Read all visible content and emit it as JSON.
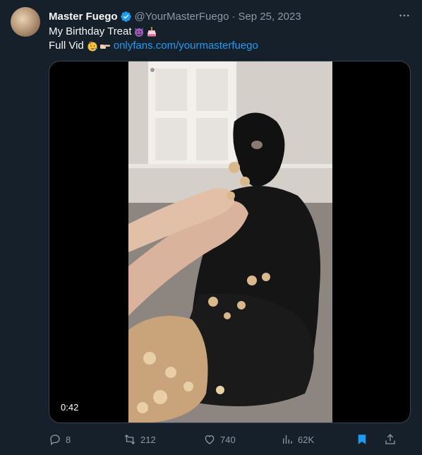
{
  "tweet": {
    "display_name": "Master Fuego",
    "handle": "@YourMasterFuego",
    "separator": "·",
    "date": "Sep 25, 2023",
    "line1_text": "My Birthday Treat",
    "line2_text": "Full Vid",
    "link_text": "onlyfans.com/yourmasterfuego",
    "emoji_line1": [
      "smiling-devil-emoji",
      "birthday-cake-emoji"
    ],
    "emoji_line2": [
      "partying-face-emoji",
      "pointing-right-emoji"
    ]
  },
  "media": {
    "type": "video",
    "duration": "0:42"
  },
  "actions": {
    "replies": "8",
    "reposts": "212",
    "likes": "740",
    "views": "62K"
  },
  "colors": {
    "background": "#15202b",
    "text": "#f7f9f9",
    "muted": "#8b98a5",
    "link": "#1d9bf0",
    "verified": "#1d9bf0"
  },
  "icons": {
    "more": "more-dots-icon",
    "reply": "reply-icon",
    "repost": "repost-icon",
    "like": "heart-icon",
    "views": "views-chart-icon",
    "bookmark": "bookmark-icon",
    "share": "share-icon"
  }
}
